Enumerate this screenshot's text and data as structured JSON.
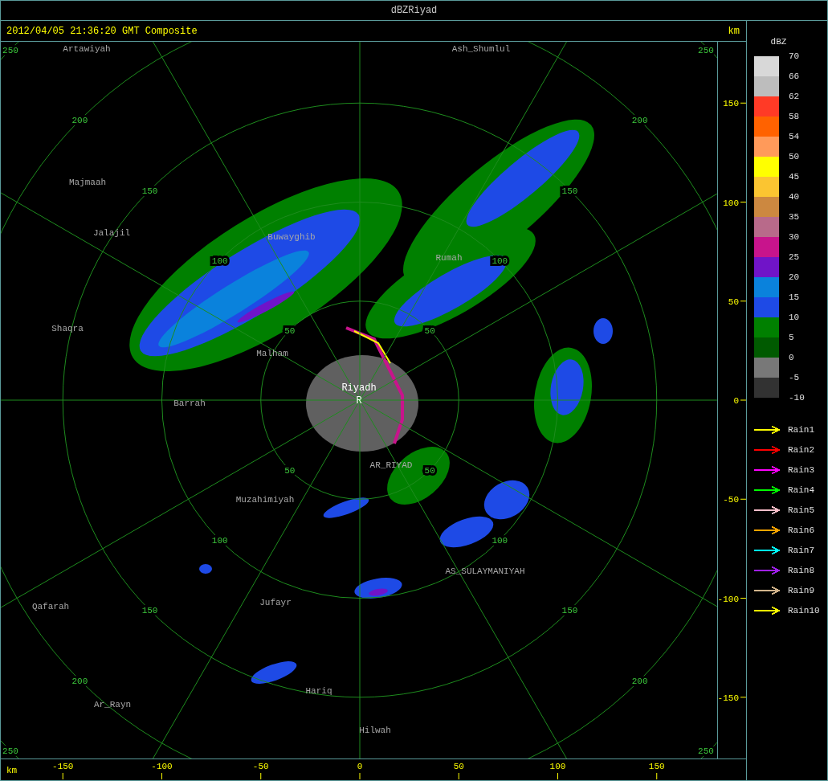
{
  "window": {
    "title": "dBZRiyad"
  },
  "header": {
    "timestamp": "2012/04/05 21:36:20 GMT Composite",
    "unit": "km"
  },
  "plot": {
    "range_rings": [
      {
        "labels": [
          "50",
          "50",
          "50",
          "50"
        ]
      },
      {
        "labels": [
          "100",
          "100",
          "100",
          "100"
        ]
      },
      {
        "labels": [
          "150",
          "150",
          "150",
          "150"
        ]
      },
      {
        "labels": [
          "200",
          "200",
          "200",
          "200"
        ]
      },
      {
        "labels": [
          "250",
          "250",
          "250",
          "250"
        ]
      }
    ],
    "places": [
      {
        "name": "Artawiyah",
        "kind": "town"
      },
      {
        "name": "Ash_Shumlul",
        "kind": "town"
      },
      {
        "name": "Majmaah",
        "kind": "town"
      },
      {
        "name": "Jalajil",
        "kind": "town"
      },
      {
        "name": "Buwayghib",
        "kind": "town"
      },
      {
        "name": "Rumah",
        "kind": "town"
      },
      {
        "name": "Shaqra",
        "kind": "town"
      },
      {
        "name": "Malham",
        "kind": "town"
      },
      {
        "name": "Riyadh",
        "kind": "site"
      },
      {
        "name": "R",
        "kind": "site"
      },
      {
        "name": "Barrah",
        "kind": "town"
      },
      {
        "name": "AR_RIYAD",
        "kind": "town"
      },
      {
        "name": "Muzahimiyah",
        "kind": "town"
      },
      {
        "name": "AS_SULAYMANIYAH",
        "kind": "town"
      },
      {
        "name": "Qafarah",
        "kind": "town"
      },
      {
        "name": "Jufayr",
        "kind": "town"
      },
      {
        "name": "Hariq",
        "kind": "town"
      },
      {
        "name": "Ar_Rayn",
        "kind": "town"
      },
      {
        "name": "Hilwah",
        "kind": "town"
      }
    ]
  },
  "y_axis": {
    "ticks": [
      "150",
      "100",
      "50",
      "0",
      "-50",
      "-100",
      "-150"
    ]
  },
  "x_axis": {
    "unit": "km",
    "ticks": [
      "-150",
      "-100",
      "-50",
      "0",
      "50",
      "100",
      "150"
    ]
  },
  "legend": {
    "title": "dBZ",
    "bins": [
      {
        "color": "#d8d8d8"
      },
      {
        "color": "#bdbdbd"
      },
      {
        "color": "#ff3a26"
      },
      {
        "color": "#ff6200"
      },
      {
        "color": "#ff9a5a"
      },
      {
        "color": "#ffff00"
      },
      {
        "color": "#fbc531"
      },
      {
        "color": "#cc8840"
      },
      {
        "color": "#b86a8a"
      },
      {
        "color": "#c8148c"
      },
      {
        "color": "#7014c8"
      },
      {
        "color": "#0a82dc"
      },
      {
        "color": "#1e4ae6"
      },
      {
        "color": "#008000"
      },
      {
        "color": "#005a00"
      },
      {
        "color": "#787878"
      },
      {
        "color": "#323232"
      }
    ],
    "labels": [
      "70",
      "66",
      "62",
      "58",
      "54",
      "50",
      "45",
      "40",
      "35",
      "30",
      "25",
      "20",
      "15",
      "10",
      "5",
      "0",
      "-5",
      "-10"
    ],
    "rain_tracks": [
      {
        "label": "Rain1",
        "color": "#ffff00"
      },
      {
        "label": "Rain2",
        "color": "#ff0000"
      },
      {
        "label": "Rain3",
        "color": "#ff00ff"
      },
      {
        "label": "Rain4",
        "color": "#00ff00"
      },
      {
        "label": "Rain5",
        "color": "#ffc0cb"
      },
      {
        "label": "Rain6",
        "color": "#ffa500"
      },
      {
        "label": "Rain7",
        "color": "#00ffff"
      },
      {
        "label": "Rain8",
        "color": "#a020f0"
      },
      {
        "label": "Rain9",
        "color": "#d2b48c"
      },
      {
        "label": "Rain10",
        "color": "#ffff00"
      }
    ]
  }
}
